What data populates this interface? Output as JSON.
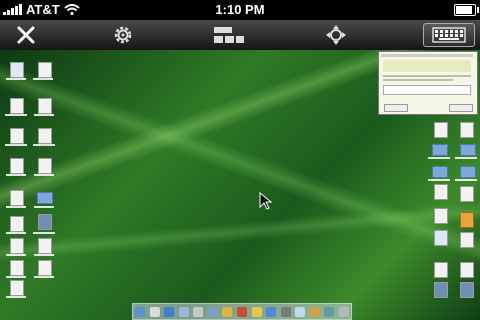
{
  "status_bar": {
    "carrier": "AT&T",
    "time": "1:10 PM",
    "battery_level": 0.9
  },
  "toolbar": {
    "icons": [
      "close-icon",
      "settings-gear-icon",
      "layout-toggle-icon",
      "move-pointer-icon",
      "keyboard-icon"
    ]
  },
  "desktop": {
    "wallpaper": "green-grass-with-dew",
    "cursor": "mouse-pointer-icon"
  },
  "colors": {
    "toolbar_top": "#4a4a4a",
    "toolbar_bottom": "#151515",
    "grass_dark": "#0d3a12",
    "grass_light": "#3c8a2a"
  }
}
